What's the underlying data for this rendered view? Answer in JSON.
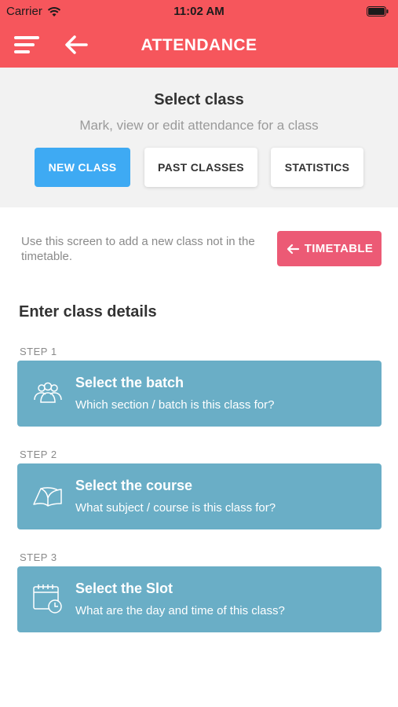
{
  "status_bar": {
    "carrier": "Carrier",
    "time": "11:02 AM",
    "wifi_icon": "wifi-icon",
    "battery_icon": "battery-icon"
  },
  "app_bar": {
    "title": "ATTENDANCE",
    "menu_icon": "hamburger-menu-icon",
    "back_icon": "arrow-left-icon",
    "color": "#f6565c"
  },
  "select_panel": {
    "title": "Select class",
    "subtitle": "Mark, view or edit attendance for a class",
    "tabs": [
      {
        "label": "NEW CLASS",
        "selected": true
      },
      {
        "label": "PAST CLASSES",
        "selected": false
      },
      {
        "label": "STATISTICS",
        "selected": false
      }
    ],
    "active_color": "#3eaaf3"
  },
  "info": {
    "text": "Use this screen to add a new class not in the timetable.",
    "timetable_button": "TIMETABLE",
    "timetable_icon": "arrow-left-icon",
    "button_color": "#ec5a75"
  },
  "details": {
    "heading": "Enter class details",
    "card_color": "#6aaec6",
    "steps": [
      {
        "step": "STEP 1",
        "title": "Select the batch",
        "description": "Which section / batch is this class for?",
        "icon": "group-icon"
      },
      {
        "step": "STEP 2",
        "title": "Select the course",
        "description": "What subject / course is this class for?",
        "icon": "open-book-icon"
      },
      {
        "step": "STEP 3",
        "title": "Select the Slot",
        "description": "What are the day and time of this class?",
        "icon": "calendar-clock-icon"
      }
    ]
  }
}
